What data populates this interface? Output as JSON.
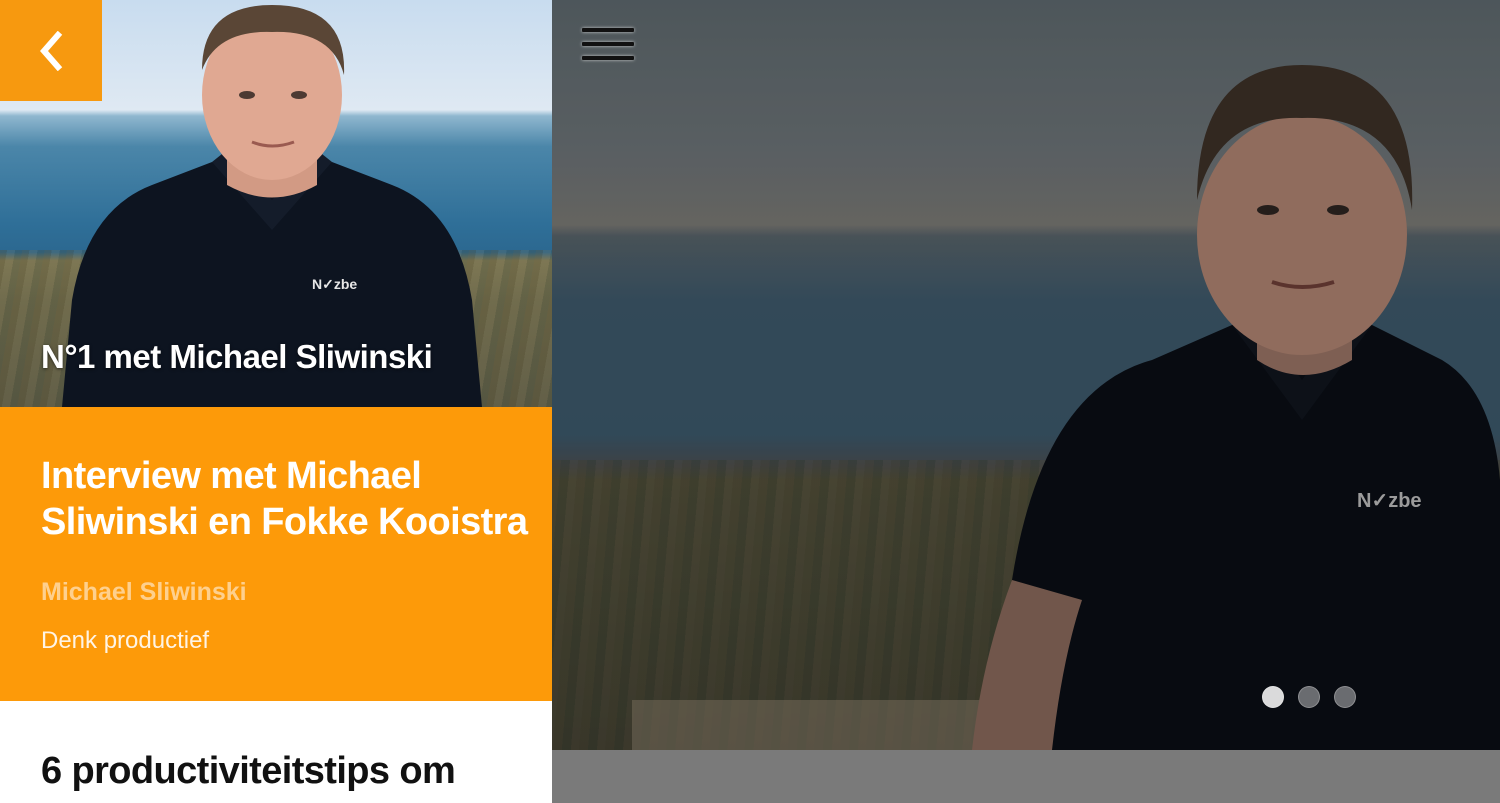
{
  "left": {
    "back_icon": "chevron-left-icon",
    "thumbnail": {
      "caption": "N°1 met Michael Sliwinski",
      "shirt_logo": "N✓zbe"
    },
    "article": {
      "title": "Interview met Michael Sliwinski en Fokke Kooistra",
      "author": "Michael Sliwinski",
      "category": "Denk productief"
    },
    "next_article": {
      "title": "6 productiviteitstips om"
    }
  },
  "right": {
    "menu_icon": "hamburger-menu-icon",
    "hero": {
      "shirt_logo": "N✓zbe"
    },
    "pagination": {
      "count": 3,
      "active_index": 0
    }
  },
  "colors": {
    "accent": "#fd9a09",
    "back_button": "#f7990f",
    "author_text": "#fed08e",
    "bottom_bar": "#7a7a7a"
  }
}
